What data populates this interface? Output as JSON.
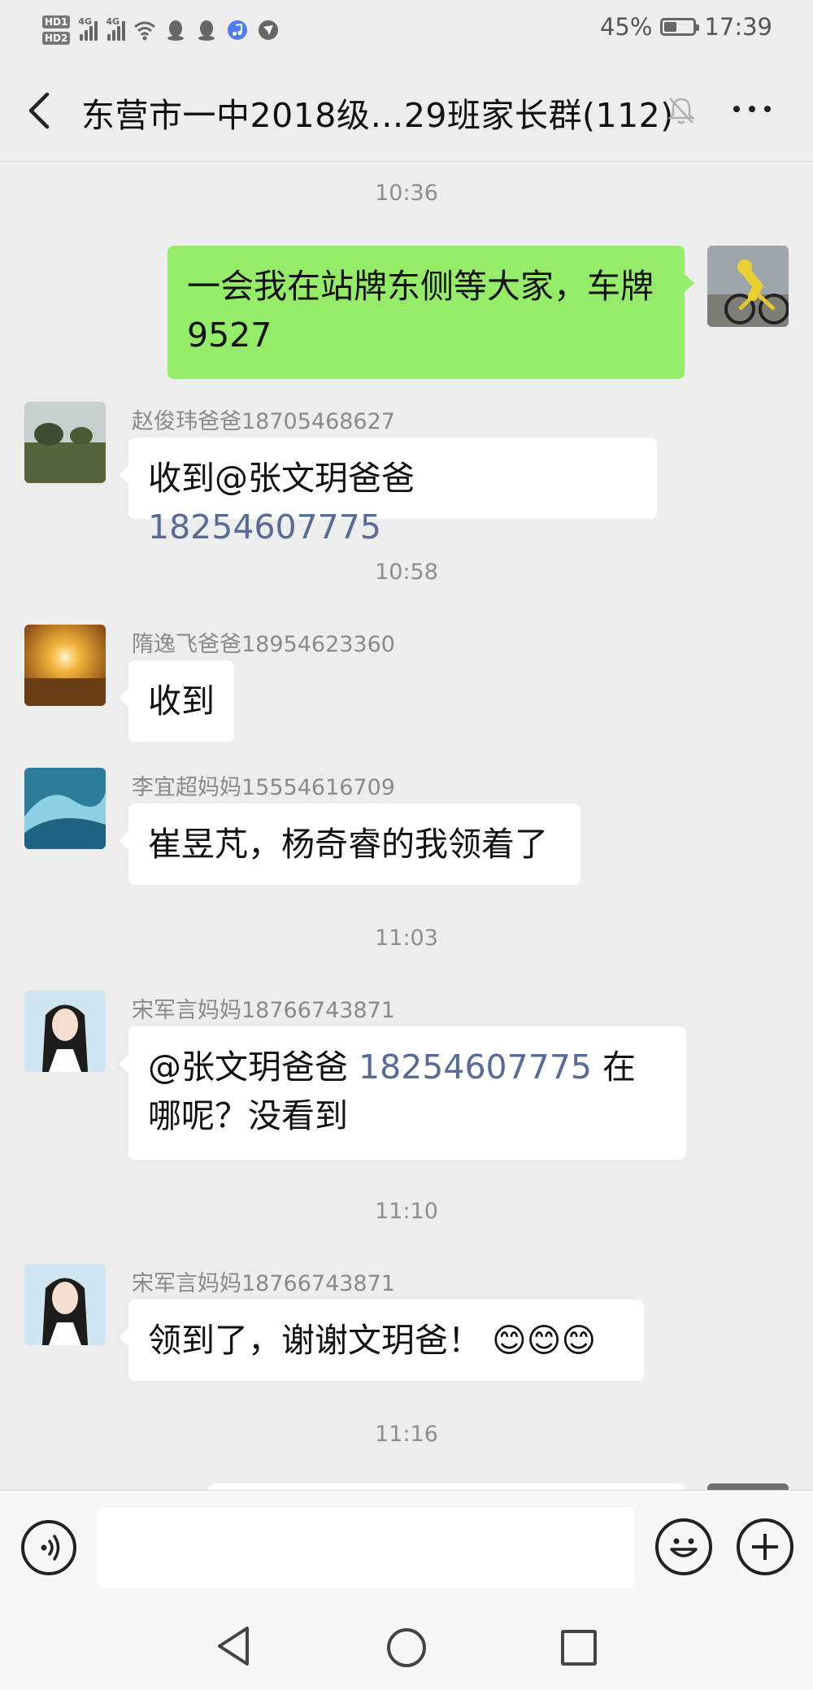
{
  "status_bar": {
    "hd1": "HD1",
    "hd2": "HD2",
    "net1": "4G",
    "net2": "4G",
    "battery_percent": "45%",
    "battery_level": 0.45,
    "time": "17:39"
  },
  "nav": {
    "title": "东营市一中2018级…29班家长群(112)"
  },
  "messages": [
    {
      "type": "time",
      "text": "10:36"
    },
    {
      "type": "mine",
      "text": "一会我在站牌东侧等大家，车牌9527"
    },
    {
      "type": "in",
      "sender": "赵俊玮爸爸18705468627",
      "text_prefix": "收到@张文玥爸爸 ",
      "link": "18254607775"
    },
    {
      "type": "time",
      "text": "10:58"
    },
    {
      "type": "in",
      "sender": "隋逸飞爸爸18954623360",
      "text": "收到"
    },
    {
      "type": "in",
      "sender": "李宜超妈妈15554616709",
      "text": "崔昱芃，杨奇睿的我领着了"
    },
    {
      "type": "time",
      "text": "11:03"
    },
    {
      "type": "in",
      "sender": "宋军言妈妈18766743871",
      "text_prefix": "@张文玥爸爸 ",
      "link": "18254607775",
      "text_suffix": " 在哪呢？没看到"
    },
    {
      "type": "time",
      "text": "11:10"
    },
    {
      "type": "in",
      "sender": "宋军言妈妈18766743871",
      "text": "领到了，谢谢文玥爸！ 😊😊😊"
    },
    {
      "type": "time",
      "text": "11:16"
    }
  ],
  "input": {
    "placeholder": ""
  },
  "colors": {
    "background": "#ededed",
    "my_bubble": "#95ec69",
    "link": "#576b95"
  },
  "icons": [
    "back-arrow-icon",
    "mute-bell-icon",
    "more-icon",
    "voice-icon",
    "emoji-icon",
    "plus-icon"
  ]
}
